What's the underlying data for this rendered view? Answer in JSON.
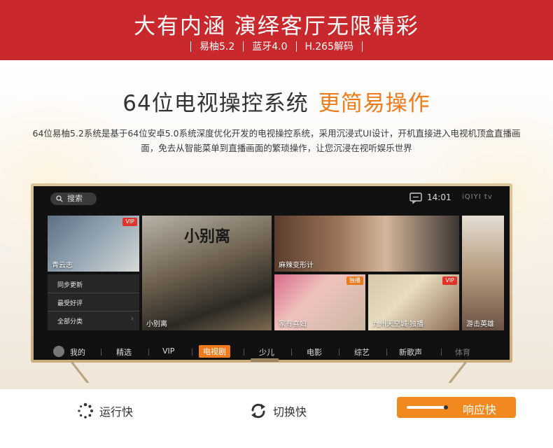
{
  "banner": {
    "title": "大有内涵  演绎客厅无限精彩",
    "specs": [
      "易柚5.2",
      "蓝牙4.0",
      "H.265解码"
    ]
  },
  "headline": {
    "dark": "64位电视操控系统",
    "orange": "更简易操作"
  },
  "description": "64位易柚5.2系统是基于64位安卓5.0系统深度优化开发的电视操控系统，采用沉浸式UI设计，开机直接进入电视机顶盒直播画面，免去从智能菜单到直播画面的繁琐操作，让您沉浸在视听娱乐世界",
  "tv": {
    "search_label": "搜索",
    "clock": "14:01",
    "brand": "iQIYI tv",
    "tiles": {
      "t1_label": "青云志",
      "t2_label": "小别离",
      "t2_title": "小别离",
      "t3_label": "麻辣变形计",
      "t4_label": "游击英雄",
      "t5_label": "家有喜妇",
      "t6_label": "九州天空城·独播",
      "vip": "VIP",
      "exclusive": "独播"
    },
    "menu": [
      "同步更新",
      "最受好评",
      "全部分类"
    ],
    "nav": [
      "我的",
      "精选",
      "VIP",
      "电视剧",
      "少儿",
      "电影",
      "综艺",
      "新歌声",
      "体育"
    ],
    "nav_active_index": 3
  },
  "features": {
    "run": "运行快",
    "switch": "切换快",
    "response": "响应快"
  },
  "colors": {
    "banner_red": "#c9282c",
    "accent_orange": "#ef7b1c",
    "button_orange": "#f1891e"
  }
}
